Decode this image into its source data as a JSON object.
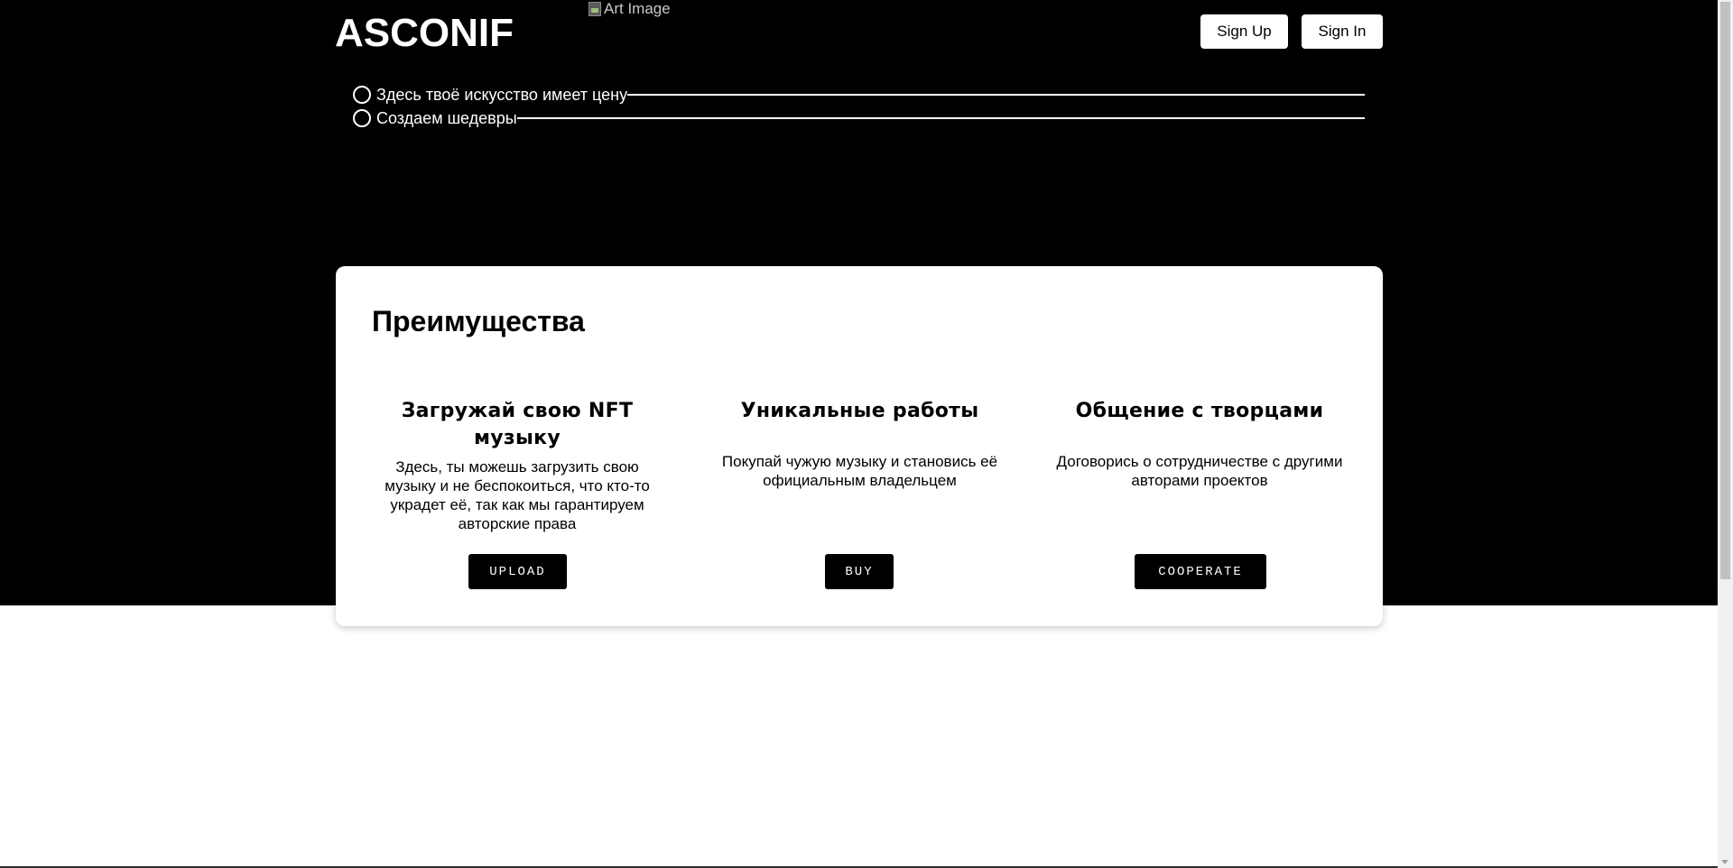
{
  "header": {
    "logo": "ASCONIF",
    "art_image_alt": "Art Image",
    "signup_label": "Sign Up",
    "signin_label": "Sign In"
  },
  "taglines": [
    "Здесь твоё искусство имеет цену",
    "Создаем шедевры"
  ],
  "advantages": {
    "title": "Преимущества",
    "features": [
      {
        "title": "Загружай свою NFT музыку",
        "description": "Здесь, ты можешь загрузить свою музыку и не беспокоиться, что кто-то украдет её, так как мы гарантируем авторские права",
        "button": "UPLOAD"
      },
      {
        "title": "Уникальные работы",
        "description": "Покупай чужую музыку и становись её официальным владельцем",
        "button": "BUY"
      },
      {
        "title": "Общение с творцами",
        "description": "Договорись о сотрудничестве с другими авторами проектов",
        "button": "COOPERATE"
      }
    ]
  },
  "colors": {
    "hero_background": "#000000",
    "card_background": "#ffffff",
    "button_dark": "#000000"
  },
  "icons": [
    "broken-image-icon",
    "circle-bullet-icon"
  ]
}
